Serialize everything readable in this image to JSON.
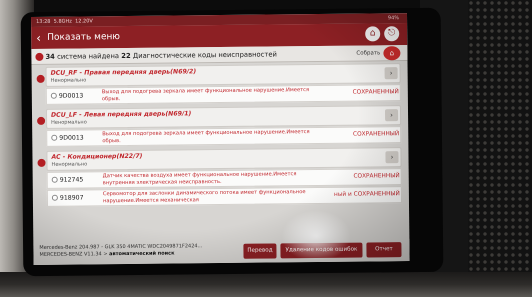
{
  "status_bar": {
    "time": "13:28",
    "signal": "5.8GHz",
    "extra": "12.20V",
    "battery": "94%"
  },
  "header": {
    "back_icon": "back-arrow-icon",
    "title": "Показать меню",
    "home_icon": "home-icon",
    "exit_icon": "exit-icon"
  },
  "summary": {
    "systems_count": "34",
    "systems_label": "система найдена",
    "codes_count": "22",
    "codes_label": "Диагностические коды неисправностей",
    "collect_label": "Собрать"
  },
  "modules": [
    {
      "name": "DCU_RF - Правая передняя дверь(N69/2)",
      "status": "Ненормально",
      "codes": [
        {
          "code": "9D0013",
          "description": "Выход для подогрева зеркала имеет функциональное нарушение.Имеется обрыв.",
          "status": "СОХРАНЕННЫЙ"
        }
      ]
    },
    {
      "name": "DCU_LF - Левая передняя дверь(N69/1)",
      "status": "Ненормально",
      "codes": [
        {
          "code": "9D0013",
          "description": "Выход для подогрева зеркала имеет функциональное нарушение.Имеется обрыв.",
          "status": "СОХРАНЕННЫЙ"
        }
      ]
    },
    {
      "name": "AC - Кондиционер(N22/7)",
      "status": "Ненормально",
      "codes": [
        {
          "code": "912745",
          "description": "Датчик качества воздуха имеет функциональное нарушение.Имеется внутренняя электрическая неисправность.",
          "status": "СОХРАНЕННЫЙ"
        },
        {
          "code": "918907",
          "description": "Сервомотор для заслонки динамического потока имеет функциональное нарушение.Имеется механическая",
          "status": "ный и СОХРАНЕННЫЙ"
        }
      ]
    }
  ],
  "footer": {
    "vehicle_line1": "Mercedes-Benz 204.987 - GLK 350 4MATIC  WDC2049871F2424...",
    "vehicle_prefix": "MERCEDES-BENZ V11.34 >",
    "vehicle_mode": "автоматический поиск",
    "translate_label": "Перевод",
    "clear_label": "Удаление кодов ошибок",
    "report_label": "Отчет"
  },
  "colors": {
    "accent": "#8d2024",
    "error": "#c1272d",
    "screen_bg": "#d7d5d2"
  }
}
